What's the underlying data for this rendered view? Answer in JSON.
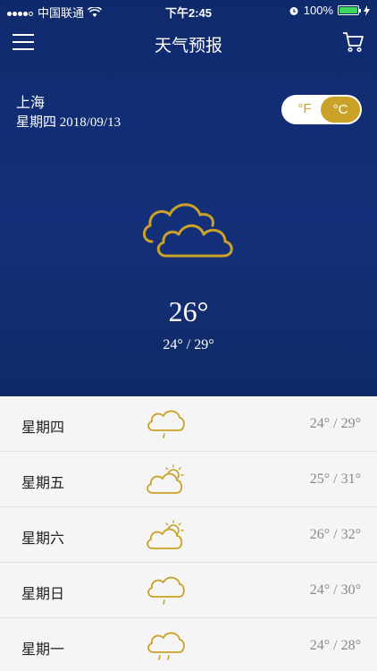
{
  "status_bar": {
    "carrier": "中国联通",
    "time": "下午2:45",
    "battery": "100%"
  },
  "nav": {
    "title": "天气预报"
  },
  "current": {
    "city": "上海",
    "weekday": "星期四",
    "date": "2018/09/13",
    "temp": "26°",
    "range": "24° / 29°",
    "icon": "cloudy-icon"
  },
  "unit_toggle": {
    "fahrenheit": "°F",
    "celsius": "°C",
    "selected": "°C"
  },
  "colors": {
    "accent": "#c9a227",
    "header_bg": "#14307a"
  },
  "forecast": [
    {
      "day": "星期四",
      "range": "24° / 29°",
      "icon": "light-rain-icon"
    },
    {
      "day": "星期五",
      "range": "25° / 31°",
      "icon": "partly-sunny-icon"
    },
    {
      "day": "星期六",
      "range": "26° / 32°",
      "icon": "partly-sunny-icon"
    },
    {
      "day": "星期日",
      "range": "24° / 30°",
      "icon": "light-rain-icon"
    },
    {
      "day": "星期一",
      "range": "24° / 28°",
      "icon": "rain-icon"
    }
  ]
}
